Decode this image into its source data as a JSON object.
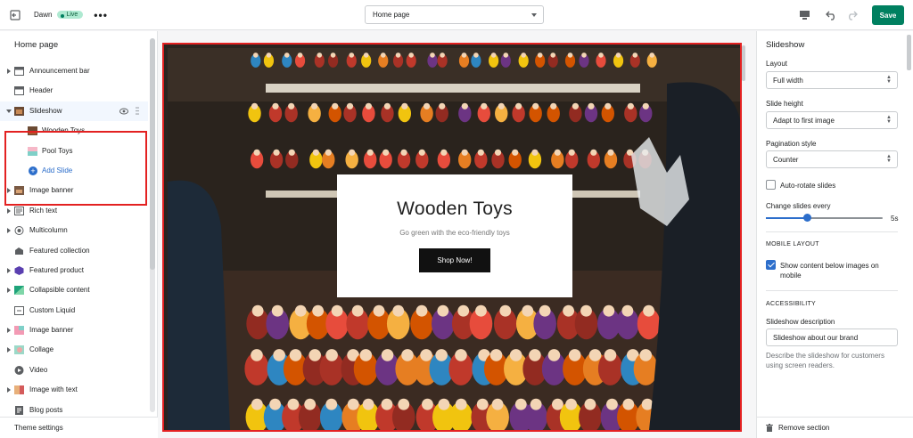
{
  "topbar": {
    "theme_name": "Dawn",
    "live_badge": "Live",
    "more_label": "•••",
    "page_select_value": "Home page",
    "save_label": "Save"
  },
  "left": {
    "title": "Home page",
    "sections": [
      {
        "label": "Announcement bar",
        "icon": "announcement-icon",
        "expandable": true
      },
      {
        "label": "Header",
        "icon": "header-icon",
        "expandable": false
      },
      {
        "label": "Slideshow",
        "icon": "slideshow-icon",
        "expandable": true,
        "expanded": true
      },
      {
        "label": "Wooden Toys",
        "icon": "image-thumb-icon",
        "child": true
      },
      {
        "label": "Pool Toys",
        "icon": "image-thumb-icon",
        "child": true
      },
      {
        "label": "Add Slide",
        "icon": "plus-circle-icon",
        "child": true,
        "action": true
      },
      {
        "label": "Image banner",
        "icon": "image-banner-icon",
        "expandable": true
      },
      {
        "label": "Rich text",
        "icon": "rich-text-icon",
        "expandable": true
      },
      {
        "label": "Multicolumn",
        "icon": "multicolumn-icon",
        "expandable": true
      },
      {
        "label": "Featured collection",
        "icon": "collection-icon",
        "expandable": false
      },
      {
        "label": "Featured product",
        "icon": "product-icon",
        "expandable": true
      },
      {
        "label": "Collapsible content",
        "icon": "collapsible-icon",
        "expandable": true
      },
      {
        "label": "Custom Liquid",
        "icon": "code-icon",
        "expandable": false
      },
      {
        "label": "Image banner",
        "icon": "image-banner-icon",
        "expandable": true
      },
      {
        "label": "Collage",
        "icon": "collage-icon",
        "expandable": true
      },
      {
        "label": "Video",
        "icon": "play-icon",
        "expandable": false
      },
      {
        "label": "Image with text",
        "icon": "image-text-icon",
        "expandable": true
      },
      {
        "label": "Blog posts",
        "icon": "blog-icon",
        "expandable": false
      }
    ],
    "footer": "Theme settings"
  },
  "preview": {
    "heading": "Wooden Toys",
    "subheading": "Go green with the eco-friendly toys",
    "button": "Shop Now!"
  },
  "right": {
    "title": "Slideshow",
    "layout_label": "Layout",
    "layout_value": "Full width",
    "slide_height_label": "Slide height",
    "slide_height_value": "Adapt to first image",
    "pagination_label": "Pagination style",
    "pagination_value": "Counter",
    "autorotate_label": "Auto-rotate slides",
    "autorotate_checked": false,
    "change_every_label": "Change slides every",
    "change_every_value": "5s",
    "change_every_fraction": 0.35,
    "mobile_heading": "MOBILE LAYOUT",
    "mobile_checkbox_label": "Show content below images on mobile",
    "mobile_checked": true,
    "accessibility_heading": "ACCESSIBILITY",
    "description_label": "Slideshow description",
    "description_value": "Slideshow about our brand",
    "description_help": "Describe the slideshow for customers using screen readers.",
    "remove_label": "Remove section"
  },
  "colors": {
    "primary": "#008060",
    "link": "#2c6ecb",
    "highlight": "#e32121"
  }
}
